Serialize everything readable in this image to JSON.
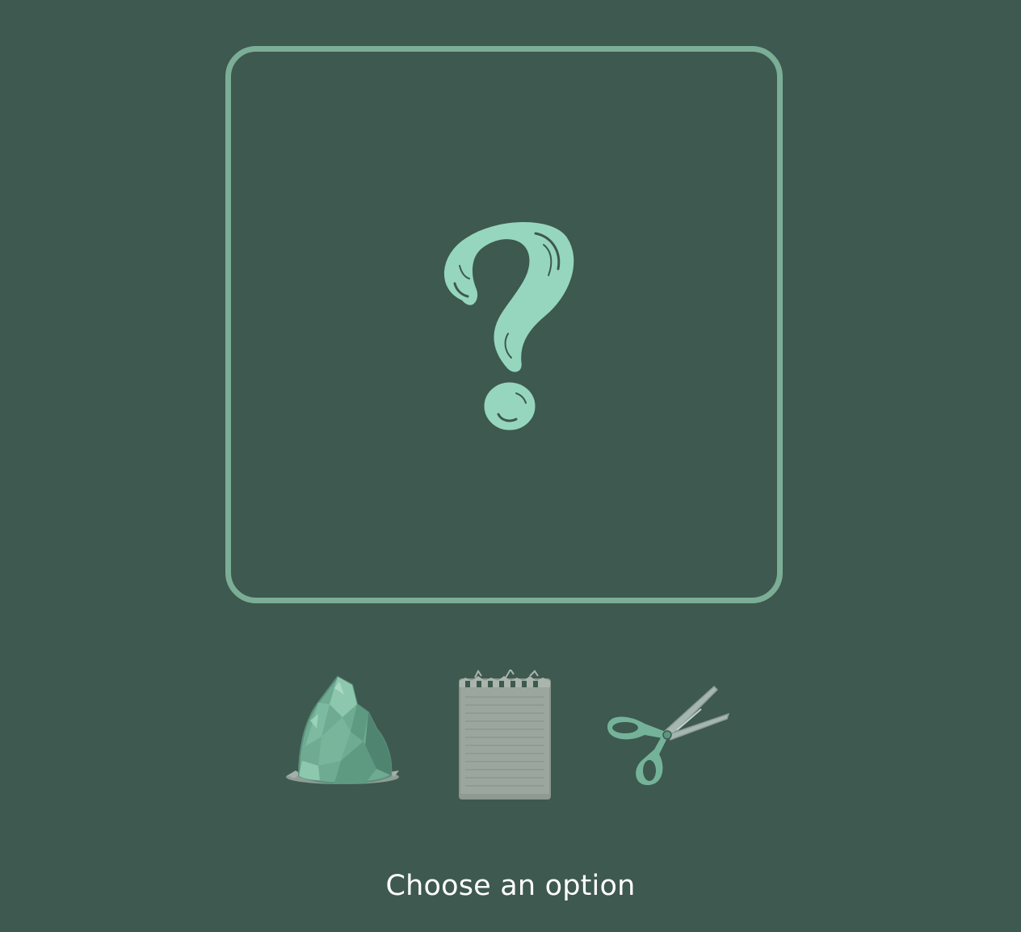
{
  "result": {
    "icon": "question-mark-icon"
  },
  "choices": [
    {
      "id": "rock",
      "icon": "rock-icon"
    },
    {
      "id": "paper",
      "icon": "notepad-paper-icon"
    },
    {
      "id": "scissors",
      "icon": "scissors-icon"
    }
  ],
  "prompt": {
    "text": "Choose an option"
  },
  "colors": {
    "background": "#3e594f",
    "frame": "#7cae97",
    "accent": "#96d6be",
    "prompt_text": "#ffffff"
  }
}
